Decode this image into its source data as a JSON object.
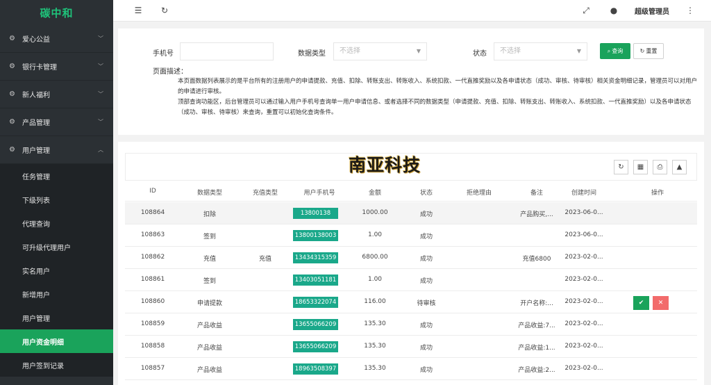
{
  "sidebar": {
    "brand": "碳中和",
    "groups": [
      {
        "label": "爱心公益",
        "icon": "gear-icon"
      },
      {
        "label": "银行卡管理",
        "icon": "gear-icon"
      },
      {
        "label": "新人福利",
        "icon": "gear-icon"
      },
      {
        "label": "产品管理",
        "icon": "gear-icon"
      },
      {
        "label": "用户管理",
        "icon": "gear-icon",
        "expanded": true
      }
    ],
    "sub_items": [
      {
        "label": "任务管理"
      },
      {
        "label": "下级列表"
      },
      {
        "label": "代理查询"
      },
      {
        "label": "可升级代理用户"
      },
      {
        "label": "实名用户"
      },
      {
        "label": "新增用户"
      },
      {
        "label": "用户管理"
      },
      {
        "label": "用户资金明细",
        "active": true
      },
      {
        "label": "用户签到记录"
      }
    ]
  },
  "topbar": {
    "admin_name": "超级管理员",
    "icons": [
      "menu-fold-icon",
      "refresh-icon",
      "fullscreen-icon",
      "globe-icon",
      "more-vertical-icon"
    ]
  },
  "filter": {
    "phone_label": "手机号",
    "phone_value": "",
    "type_label": "数据类型",
    "type_placeholder": "不选择",
    "status_label": "状态",
    "status_placeholder": "不选择",
    "query_label": "查询",
    "reset_label": "重置",
    "desc_title": "页面描述：",
    "desc_1": "本页面数据列表展示的是平台所有的注册用户的申请提款、充值、扣除、转账支出、转账收入、系统扣款、一代直推奖励以及各申请状态（成功、审核、待审核）相关资金明细记录，管理员可以对用户的申请进行审核。",
    "desc_2": "顶部查询功能区，后台管理员可以通过输入用户手机号查询单一用户申请信息、或者选择不同的数据类型（申请提款、充值、扣除、转账支出、转账收入、系统扣款、一代直推奖励）以及各申请状态（成功、审核、待审核）来查询，重置可以初始化查询条件。"
  },
  "logo_text": "南亚科技",
  "table": {
    "headers": [
      "ID",
      "数据类型",
      "充值类型",
      "用户手机号",
      "金额",
      "状态",
      "拒绝理由",
      "备注",
      "创建时间",
      "操作"
    ],
    "rows": [
      {
        "id": "108864",
        "type": "扣除",
        "recharge": "",
        "phone": "13800138",
        "amount": "1000.00",
        "status": "成功",
        "reason": "",
        "note": "产品购买,...",
        "time": "2023-06-0..."
      },
      {
        "id": "108863",
        "type": "签到",
        "recharge": "",
        "phone": "13800138003",
        "amount": "1.00",
        "status": "成功",
        "reason": "",
        "note": "",
        "time": "2023-06-0..."
      },
      {
        "id": "108862",
        "type": "充值",
        "recharge": "充值",
        "phone": "13434315359",
        "amount": "6800.00",
        "status": "成功",
        "reason": "",
        "note": "充值6800",
        "time": "2023-02-0..."
      },
      {
        "id": "108861",
        "type": "签到",
        "recharge": "",
        "phone": "13403051181",
        "amount": "1.00",
        "status": "成功",
        "reason": "",
        "note": "",
        "time": "2023-02-0..."
      },
      {
        "id": "108860",
        "type": "申请提款",
        "recharge": "",
        "phone": "18653322074",
        "amount": "116.00",
        "status": "待审核",
        "reason": "",
        "note": "开户名称:...",
        "time": "2023-02-0...",
        "actions": true
      },
      {
        "id": "108859",
        "type": "产品收益",
        "recharge": "",
        "phone": "13655066209",
        "amount": "135.30",
        "status": "成功",
        "reason": "",
        "note": "产品收益:7...",
        "time": "2023-02-0..."
      },
      {
        "id": "108858",
        "type": "产品收益",
        "recharge": "",
        "phone": "13655066209",
        "amount": "135.30",
        "status": "成功",
        "reason": "",
        "note": "产品收益:1...",
        "time": "2023-02-0..."
      },
      {
        "id": "108857",
        "type": "产品收益",
        "recharge": "",
        "phone": "18963508397",
        "amount": "135.30",
        "status": "成功",
        "reason": "",
        "note": "产品收益:2...",
        "time": "2023-02-0..."
      }
    ]
  }
}
